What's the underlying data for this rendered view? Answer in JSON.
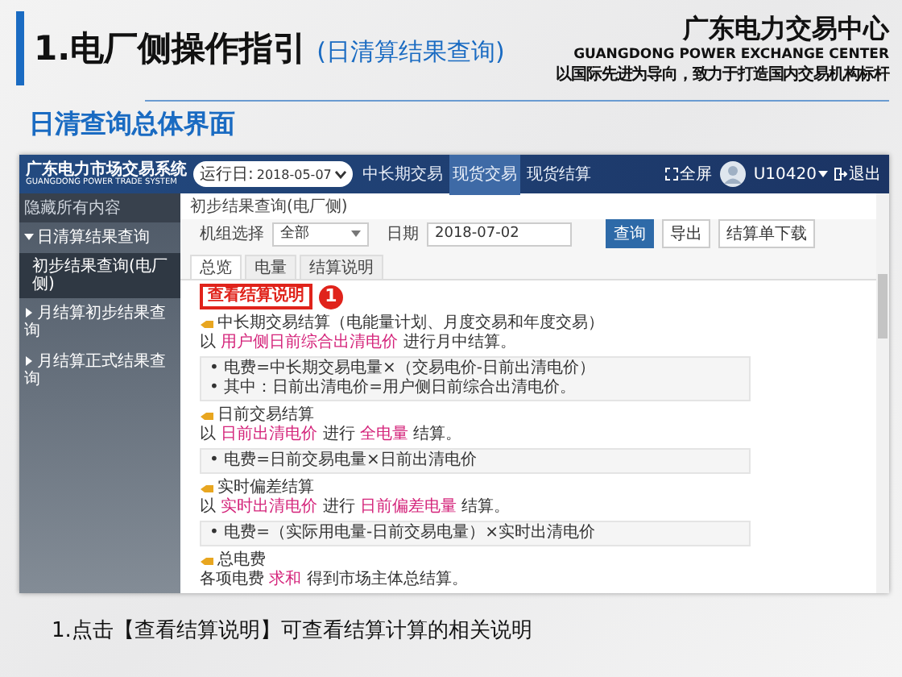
{
  "slide": {
    "title": "1.电厂侧操作指引",
    "title_note": "(日清算结果查询)",
    "org": {
      "name": "广东电力交易中心",
      "english": "GUANGDONG POWER EXCHANGE CENTER",
      "slogan": "以国际先进为导向，致力于打造国内交易机构标杆"
    },
    "section_title": "日清查询总体界面",
    "caption": "1.点击【查看结算说明】可查看结算计算的相关说明"
  },
  "screenshot": {
    "app": {
      "title": "广东电力市场交易系统",
      "subtitle": "GUANGDONG POWER TRADE SYSTEM"
    },
    "run_date": {
      "label": "运行日:",
      "value": "2018-05-07"
    },
    "nav": [
      {
        "label": "中长期交易",
        "selected": false
      },
      {
        "label": "现货交易",
        "selected": true
      },
      {
        "label": "现货结算",
        "selected": false
      }
    ],
    "fullscreen": "全屏",
    "user": "U10420",
    "logout": "退出",
    "sidebar": {
      "header": "隐藏所有内容",
      "items": [
        {
          "label": "日清算结果查询",
          "expanded": true,
          "selected": false,
          "children": [
            {
              "label": "初步结果查询(电厂侧)",
              "selected": true
            }
          ]
        },
        {
          "label": "月结算初步结果查询",
          "expanded": false,
          "selected": false
        },
        {
          "label": "月结算正式结果查询",
          "expanded": false,
          "selected": false
        }
      ]
    },
    "breadcrumb": "初步结果查询(电厂侧)",
    "filters": [
      {
        "label": "机组选择",
        "kind": "select",
        "value": "全部"
      },
      {
        "label": "日期",
        "kind": "date",
        "value": "2018-07-02"
      }
    ],
    "buttons": [
      {
        "label": "查询",
        "kind": "primary"
      },
      {
        "label": "导出",
        "kind": "default"
      },
      {
        "label": "结算单下载",
        "kind": "default"
      }
    ],
    "tabs": [
      {
        "label": "总览",
        "selected": true
      },
      {
        "label": "电量",
        "selected": false
      },
      {
        "label": "结算说明",
        "selected": false
      }
    ],
    "explain_button": "查看结算说明",
    "callout": "1",
    "sections": [
      {
        "heading": "中长期交易结算（电能量计划、月度交易和年度交易）",
        "rule": [
          {
            "text": "以 ",
            "highlight": false
          },
          {
            "text": "用户侧日前综合出清电价",
            "highlight": true
          },
          {
            "text": " 进行月中结算。",
            "highlight": false
          }
        ],
        "formulas": [
          "• 电费=中长期交易电量×（交易电价-日前出清电价）",
          "• 其中：日前出清电价=用户侧日前综合出清电价。"
        ]
      },
      {
        "heading": "日前交易结算",
        "rule": [
          {
            "text": "以 ",
            "highlight": false
          },
          {
            "text": "日前出清电价",
            "highlight": true
          },
          {
            "text": " 进行 ",
            "highlight": false
          },
          {
            "text": "全电量",
            "highlight": true
          },
          {
            "text": " 结算。",
            "highlight": false
          }
        ],
        "formulas": [
          "• 电费=日前交易电量×日前出清电价"
        ]
      },
      {
        "heading": "实时偏差结算",
        "rule": [
          {
            "text": "以 ",
            "highlight": false
          },
          {
            "text": "实时出清电价",
            "highlight": true
          },
          {
            "text": " 进行 ",
            "highlight": false
          },
          {
            "text": "日前偏差电量",
            "highlight": true
          },
          {
            "text": " 结算。",
            "highlight": false
          }
        ],
        "formulas": [
          "• 电费=（实际用电量-日前交易电量）×实时出清电价"
        ]
      },
      {
        "heading": "总电费",
        "rule": [
          {
            "text": "各项电费 ",
            "highlight": false
          },
          {
            "text": "求和",
            "highlight": true
          },
          {
            "text": " 得到市场主体总结算。",
            "highlight": false
          }
        ]
      }
    ]
  }
}
